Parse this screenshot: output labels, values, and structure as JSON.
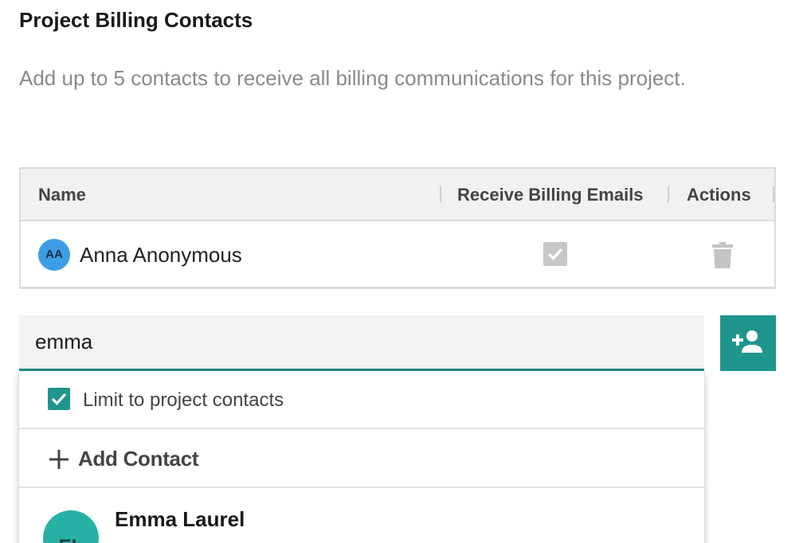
{
  "header": {
    "title": "Project Billing Contacts",
    "description": "Add up to 5 contacts to receive all billing communications for this project."
  },
  "table": {
    "columns": {
      "name": "Name",
      "receive_emails": "Receive Billing Emails",
      "actions": "Actions"
    },
    "rows": [
      {
        "initials": "AA",
        "name": "Anna Anonymous",
        "receive_emails": true,
        "avatar_color": "#3c9de6"
      }
    ]
  },
  "search": {
    "value": "emma"
  },
  "dropdown": {
    "limit_label": "Limit to project contacts",
    "limit_checked": true,
    "add_contact_label": "Add Contact",
    "results": [
      {
        "initials": "EL",
        "name": "Emma Laurel",
        "avatar_color": "#27b1a5"
      }
    ]
  },
  "colors": {
    "accent": "#1f968d"
  },
  "icons": {
    "add_person": "add-person-icon",
    "delete": "trash-icon",
    "plus": "plus-icon",
    "check": "checkmark-icon"
  }
}
